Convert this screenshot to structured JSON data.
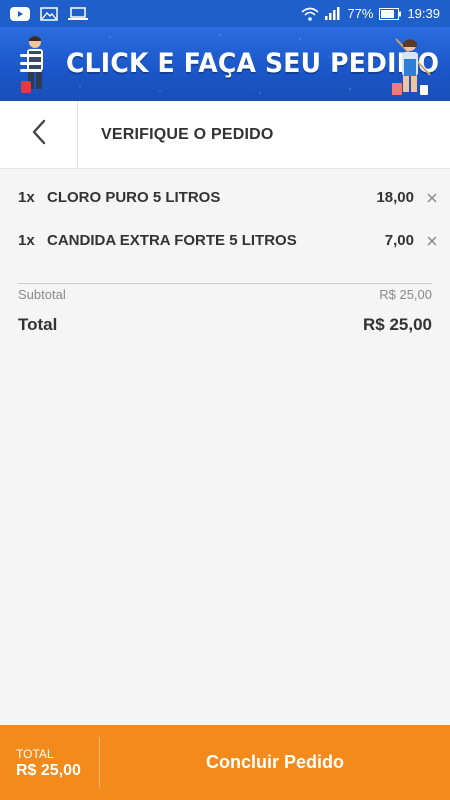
{
  "status_bar": {
    "battery": "77%",
    "time": "19:39",
    "icons": [
      "youtube-icon",
      "gallery-icon",
      "laptop-icon",
      "wifi-icon",
      "signal-icon",
      "battery-icon"
    ]
  },
  "banner": {
    "title": "CLICK E FAÇA SEU PEDIDO",
    "menu_icon": "menu-icon"
  },
  "header": {
    "title": "VERIFIQUE O PEDIDO",
    "back_icon": "chevron-left-icon"
  },
  "items": [
    {
      "qty": "1x",
      "name": "CLORO PURO 5 LITROS",
      "price": "18,00"
    },
    {
      "qty": "1x",
      "name": "CANDIDA EXTRA FORTE 5 LITROS",
      "price": "7,00"
    }
  ],
  "summary": {
    "subtotal_label": "Subtotal",
    "subtotal_value": "R$ 25,00",
    "total_label": "Total",
    "total_value": "R$ 25,00"
  },
  "footer": {
    "total_label": "TOTAL",
    "total_value": "R$ 25,00",
    "checkout_label": "Concluir Pedido"
  },
  "colors": {
    "status_bar": "#1e5fc9",
    "banner": "#1a56c8",
    "footer": "#f28a1c"
  }
}
